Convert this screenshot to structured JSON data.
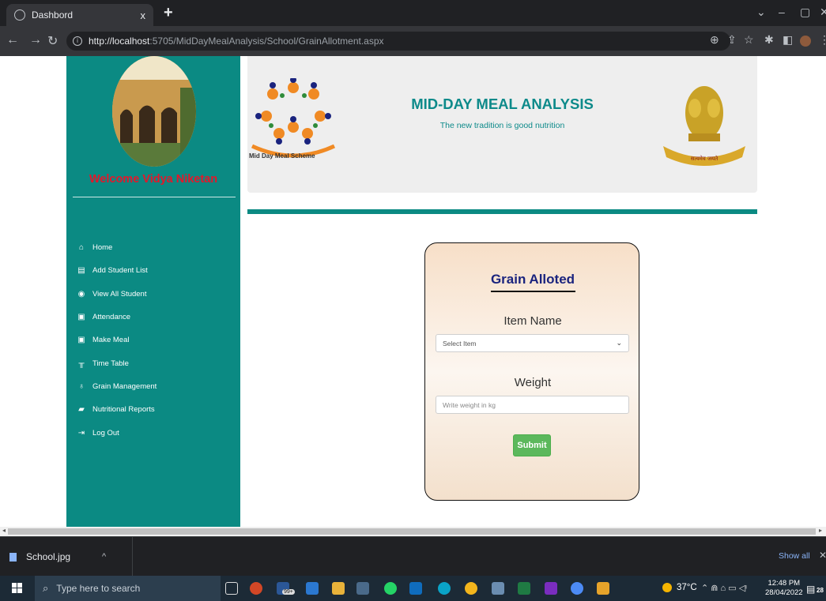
{
  "browser": {
    "tab_title": "Dashbord",
    "tab_close": "x",
    "new_tab": "+",
    "url_host": "http://localhost",
    "url_rest": ":5705/MidDayMealAnalysis/School/GrainAllotment.aspx"
  },
  "sidebar": {
    "welcome": "Welcome Vidya Niketan",
    "items": [
      {
        "label": "Home",
        "icon": "home-icon"
      },
      {
        "label": "Add Student List",
        "icon": "add-student-icon"
      },
      {
        "label": "View All Student",
        "icon": "eye-icon"
      },
      {
        "label": "Attendance",
        "icon": "attendance-icon"
      },
      {
        "label": "Make Meal",
        "icon": "meal-icon"
      },
      {
        "label": "Time Table",
        "icon": "timetable-icon"
      },
      {
        "label": "Grain Management",
        "icon": "grain-icon"
      },
      {
        "label": "Nutritional Reports",
        "icon": "folder-icon"
      },
      {
        "label": "Log Out",
        "icon": "logout-icon"
      }
    ]
  },
  "banner": {
    "logo_caption": "Mid Day Meal Scheme",
    "title": "MID-DAY MEAL ANALYSIS",
    "subtitle": "The new tradition is good nutrition",
    "emblem_text": "सत्यमेव जयते"
  },
  "form": {
    "heading": "Grain Alloted",
    "item_label": "Item Name",
    "item_selected": "Select Item",
    "weight_label": "Weight",
    "weight_placeholder": "Write weight in kg",
    "submit_label": "Submit"
  },
  "downloads": {
    "file_name": "School.jpg",
    "show_all": "Show all"
  },
  "taskbar": {
    "search_placeholder": "Type here to search",
    "mail_badge": "99+",
    "temperature": "37°C",
    "time": "12:48 PM",
    "date": "28/04/2022",
    "notification_count": "28"
  },
  "colors": {
    "sidebar": "#0b8a83",
    "welcome_text": "#e3172a",
    "banner_title": "#0d8a8a",
    "heading": "#1a237e",
    "submit": "#5cb85c"
  }
}
